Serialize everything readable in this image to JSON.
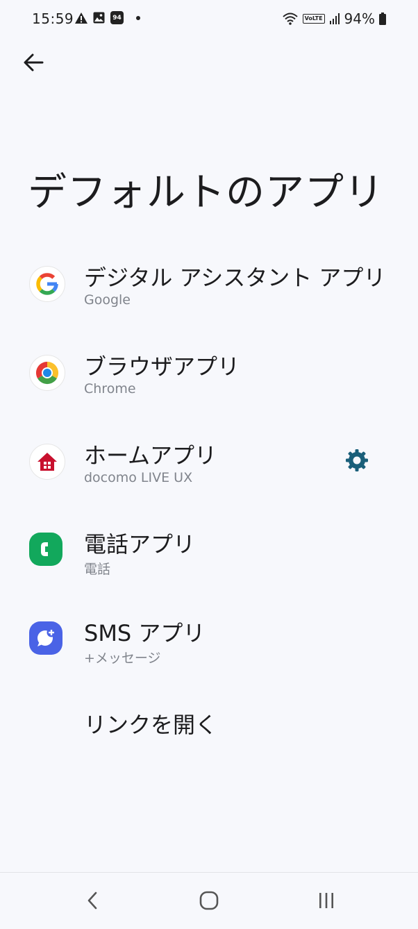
{
  "status_bar": {
    "time": "15:59",
    "calendar_badge": "94",
    "battery": "94%"
  },
  "page": {
    "title": "デフォルトのアプリ"
  },
  "items": [
    {
      "title": "デジタル アシスタント アプリ",
      "subtitle": "Google",
      "icon": "google-icon"
    },
    {
      "title": "ブラウザアプリ",
      "subtitle": "Chrome",
      "icon": "chrome-icon"
    },
    {
      "title": "ホームアプリ",
      "subtitle": "docomo LIVE UX",
      "icon": "home-app-icon"
    },
    {
      "title": "電話アプリ",
      "subtitle": "電話",
      "icon": "phone-app-icon"
    },
    {
      "title": "SMS アプリ",
      "subtitle": "+メッセージ",
      "icon": "plus-message-icon"
    },
    {
      "title": "リンクを開く"
    }
  ],
  "colors": {
    "background": "#f7f8fc",
    "gear": "#1a5f7a",
    "home_icon": "#c8102e",
    "phone_icon": "#12a85c",
    "sms_icon": "#4a63e6"
  }
}
